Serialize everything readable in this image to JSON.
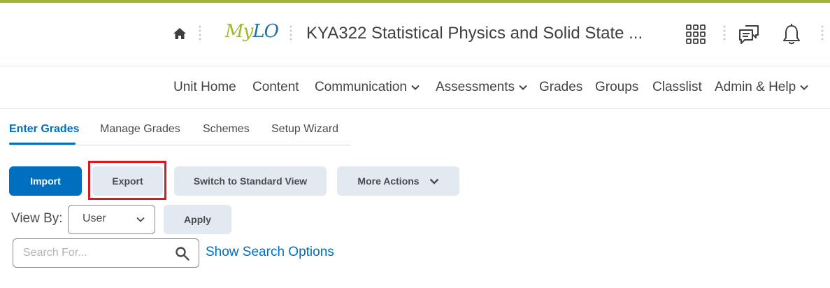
{
  "header": {
    "logo_part1": "My",
    "logo_part2": "LO",
    "unit_title": "KYA322 Statistical Physics and Solid State ...",
    "icons": [
      "home-icon",
      "apps-grid-icon",
      "message-alerts-icon",
      "notification-bell-icon"
    ]
  },
  "nav": {
    "items": [
      {
        "label": "Unit Home",
        "dropdown": false
      },
      {
        "label": "Content",
        "dropdown": false
      },
      {
        "label": "Communication",
        "dropdown": true
      },
      {
        "label": "Assessments",
        "dropdown": true
      },
      {
        "label": "Grades",
        "dropdown": false
      },
      {
        "label": "Groups",
        "dropdown": false
      },
      {
        "label": "Classlist",
        "dropdown": false
      },
      {
        "label": "Admin & Help",
        "dropdown": true
      }
    ]
  },
  "tabs": {
    "items": [
      {
        "label": "Enter Grades",
        "active": true
      },
      {
        "label": "Manage Grades",
        "active": false
      },
      {
        "label": "Schemes",
        "active": false
      },
      {
        "label": "Setup Wizard",
        "active": false
      }
    ]
  },
  "actions": {
    "import_label": "Import",
    "export_label": "Export",
    "switch_view_label": "Switch to Standard View",
    "more_actions_label": "More Actions"
  },
  "view_by": {
    "label": "View By:",
    "selected": "User",
    "apply_label": "Apply"
  },
  "search": {
    "placeholder": "Search For...",
    "value": "",
    "options_link": "Show Search Options"
  },
  "colors": {
    "accent_bar": "#a4b631",
    "primary": "#006fbf",
    "secondary_button": "#e3e9f1",
    "highlight": "#e3151a"
  }
}
